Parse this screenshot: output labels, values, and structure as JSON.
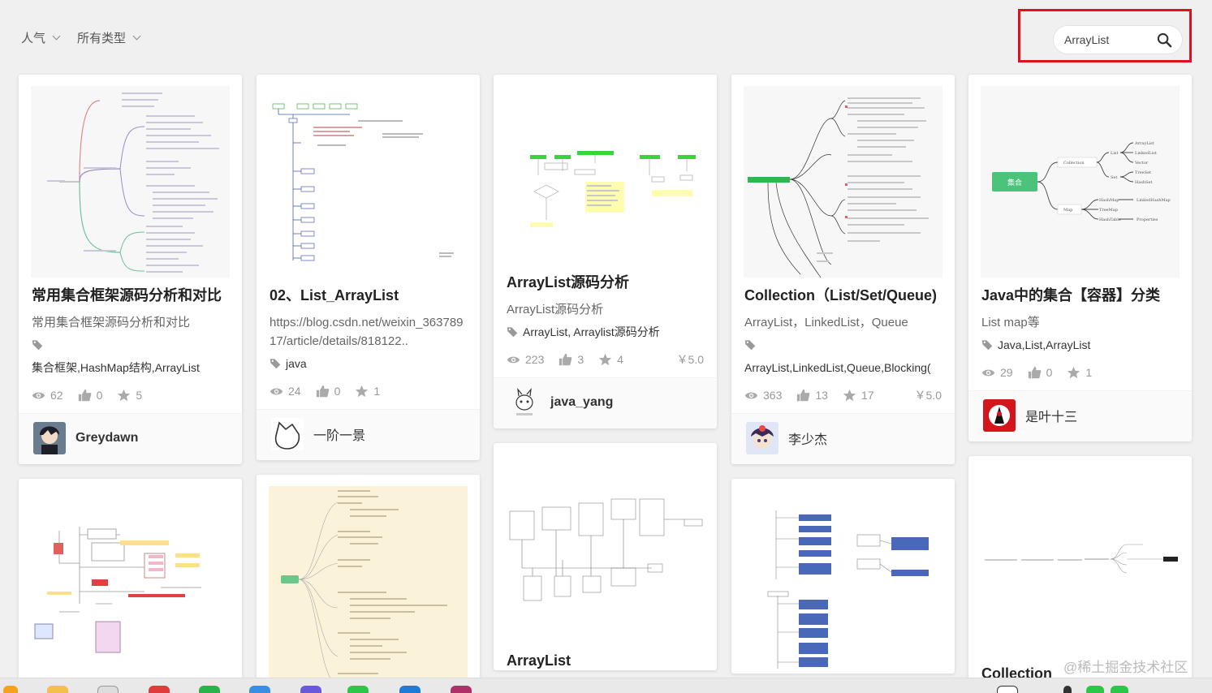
{
  "filters": [
    {
      "label": "人气"
    },
    {
      "label": "所有类型"
    }
  ],
  "search": {
    "value": "ArrayList",
    "placeholder": "ArrayList"
  },
  "cards": {
    "c1": {
      "title": "常用集合框架源码分析和对比",
      "desc": "常用集合框架源码分析和对比",
      "tags": "集合框架,HashMap结构,ArrayList",
      "views": "62",
      "likes": "0",
      "stars": "5",
      "author": "Greydawn"
    },
    "c2": {
      "title": "02、List_ArrayList",
      "desc": "https://blog.csdn.net/weixin_36378917/article/details/818122..",
      "tags": "java",
      "views": "24",
      "likes": "0",
      "stars": "1",
      "author": "一阶一景"
    },
    "c3": {
      "title": "ArrayList源码分析",
      "desc": "ArrayList源码分析",
      "tags": "ArrayList, Arraylist源码分析",
      "views": "223",
      "likes": "3",
      "stars": "4",
      "price": "￥5.0",
      "author": "java_yang"
    },
    "c4": {
      "title": "Collection（List/Set/Queue)",
      "desc": "ArrayList，LinkedList，Queue",
      "tags": "ArrayList,LinkedList,Queue,Blocking(",
      "views": "363",
      "likes": "13",
      "stars": "17",
      "price": "￥5.0",
      "author": "李少杰"
    },
    "c5": {
      "title": "Java中的集合【容器】分类",
      "desc": "List map等",
      "tags": "Java,List,ArrayList",
      "views": "29",
      "likes": "0",
      "stars": "1",
      "author": "是叶十三"
    },
    "c8": {
      "title": "ArrayList"
    },
    "c10": {
      "title": "Collection"
    }
  },
  "watermark": "@稀土掘金技术社区",
  "colors": {
    "highlight": "#e3101d",
    "accent_green": "#4cc37a"
  }
}
